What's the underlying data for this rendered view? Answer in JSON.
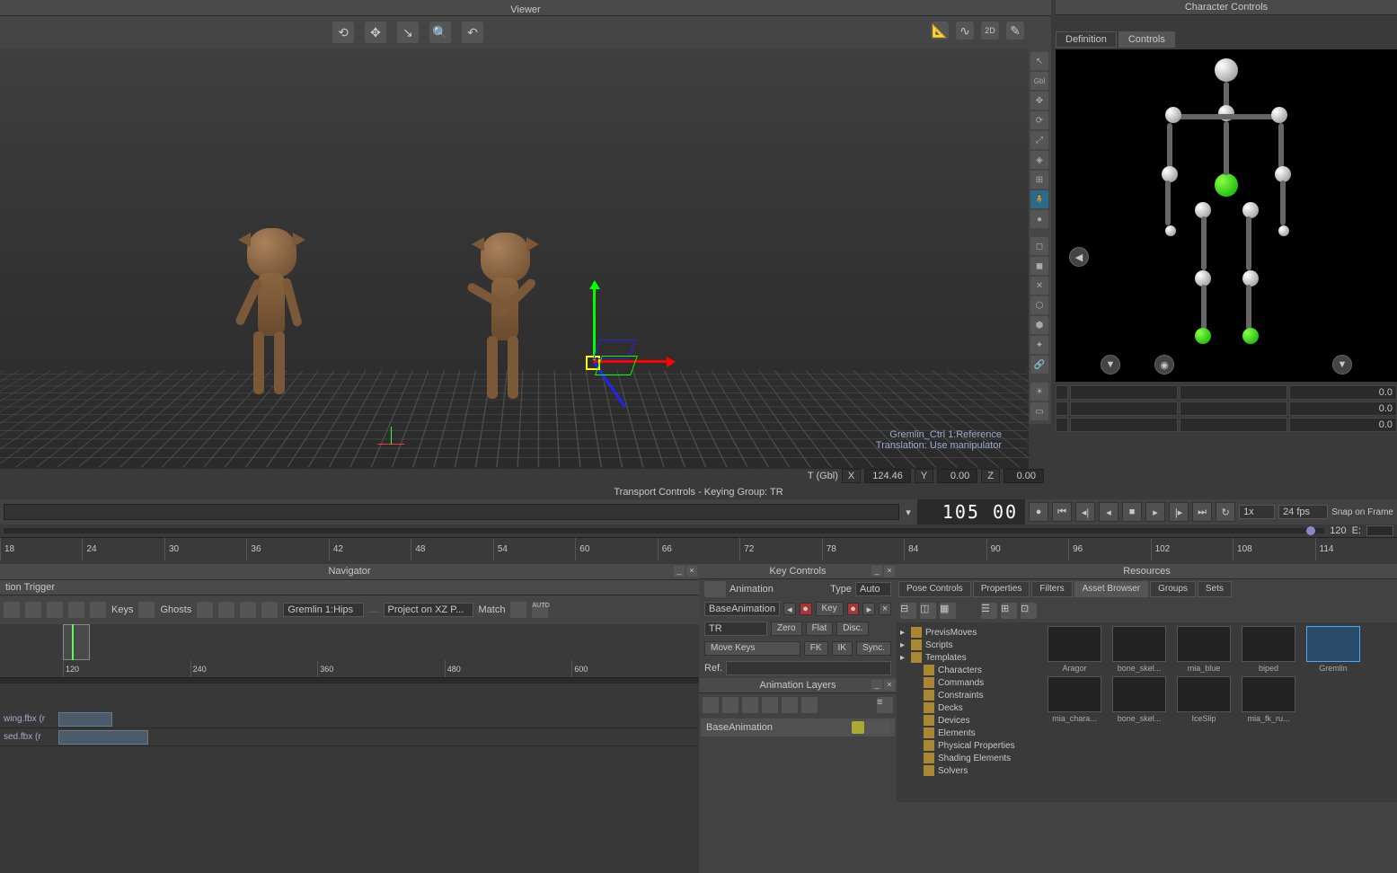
{
  "viewer": {
    "title": "Viewer",
    "info_line1": "Gremlin_Ctrl 1:Reference",
    "info_line2": "Translation: Use manipulator",
    "coord_mode": "T (Gbl)",
    "x": "124.46",
    "y": "0.00",
    "z": "0.00"
  },
  "side_tools": {
    "gbl": "Gbl"
  },
  "char_controls": {
    "title": "Character Controls",
    "tabs": [
      "Definition",
      "Controls"
    ],
    "active_tab": "Controls",
    "val1": "0.0",
    "val2": "0.0",
    "val3": "0.0"
  },
  "transport": {
    "title": "Transport Controls  -  Keying Group: TR",
    "frame": "105  00",
    "speed": "1x",
    "fps": "24 fps",
    "snap": "Snap on Frame",
    "end_frame": "120",
    "e_label": "E:",
    "ruler_ticks": [
      "18",
      "24",
      "30",
      "36",
      "42",
      "48",
      "54",
      "60",
      "66",
      "72",
      "78",
      "84",
      "90",
      "96",
      "102",
      "108",
      "114"
    ]
  },
  "navigator": {
    "title": "Navigator",
    "section": "tion Trigger",
    "keys_label": "Keys",
    "ghosts_label": "Ghosts",
    "model": "Gremlin 1:Hips",
    "project": "Project on XZ P...",
    "match": "Match",
    "ruler": [
      "120",
      "240",
      "360",
      "480",
      "600"
    ],
    "tracks": [
      {
        "label": "wing.fbx (r",
        "clip_start": 0,
        "clip_width": 60
      },
      {
        "label": "sed.fbx (r",
        "clip_start": 0,
        "clip_width": 100
      }
    ]
  },
  "key_controls": {
    "title": "Key Controls",
    "animation_label": "Animation",
    "type_label": "Type",
    "type_val": "Auto",
    "layer": "BaseAnimation",
    "key_btn": "Key",
    "mode": "TR",
    "zero": "Zero",
    "flat": "Flat",
    "disc": "Disc.",
    "move_keys": "Move Keys",
    "fk": "FK",
    "ik": "IK",
    "sync": "Sync.",
    "ref": "Ref."
  },
  "anim_layers": {
    "title": "Animation Layers",
    "base": "BaseAnimation"
  },
  "resources": {
    "title": "Resources",
    "tabs": [
      "Pose Controls",
      "Properties",
      "Filters",
      "Asset Browser",
      "Groups",
      "Sets"
    ],
    "active_tab": "Asset Browser",
    "tree": [
      {
        "label": "PrevisMoves",
        "indent": 0
      },
      {
        "label": "Scripts",
        "indent": 0
      },
      {
        "label": "Templates",
        "indent": 0
      },
      {
        "label": "Characters",
        "indent": 1
      },
      {
        "label": "Commands",
        "indent": 1
      },
      {
        "label": "Constraints",
        "indent": 1
      },
      {
        "label": "Decks",
        "indent": 1
      },
      {
        "label": "Devices",
        "indent": 1
      },
      {
        "label": "Elements",
        "indent": 1
      },
      {
        "label": "Physical Properties",
        "indent": 1
      },
      {
        "label": "Shading Elements",
        "indent": 1
      },
      {
        "label": "Solvers",
        "indent": 1
      }
    ],
    "items": [
      {
        "name": "Aragor"
      },
      {
        "name": "bone_skel..."
      },
      {
        "name": "mia_blue"
      },
      {
        "name": "biped"
      },
      {
        "name": "Gremlin",
        "selected": true
      },
      {
        "name": "mia_chara..."
      },
      {
        "name": "bone_skel..."
      },
      {
        "name": "IceSlip"
      },
      {
        "name": "mia_fk_ru..."
      }
    ]
  }
}
